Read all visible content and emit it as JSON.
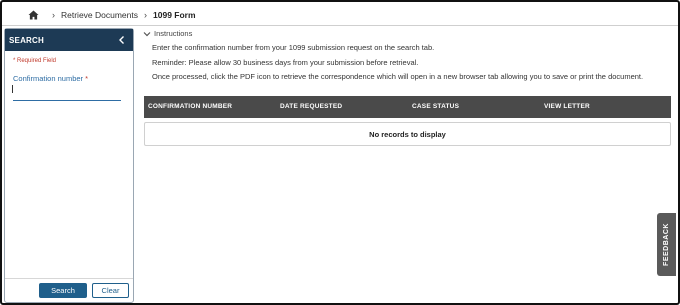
{
  "breadcrumb": {
    "home_icon": "home-icon",
    "items": [
      "Retrieve Documents",
      "1099 Form"
    ]
  },
  "sidebar": {
    "title": "SEARCH",
    "collapse_icon": "chevron-left-icon",
    "required_note": "* Required Field",
    "confirmation_label": "Confirmation number",
    "required_marker": "*",
    "confirmation_value": "",
    "search_button": "Search",
    "clear_button": "Clear"
  },
  "instructions": {
    "toggle_label": "Instructions",
    "lines": [
      "Enter the confirmation number from your 1099 submission request on the search tab.",
      "Reminder: Please allow 30 business days from your submission before retrieval.",
      "Once processed, click the PDF icon to retrieve the correspondence which will open in a new browser tab allowing you to save or print the document."
    ]
  },
  "table": {
    "columns": [
      "CONFIRMATION NUMBER",
      "DATE REQUESTED",
      "CASE STATUS",
      "VIEW LETTER"
    ],
    "empty_message": "No records to display"
  },
  "feedback": {
    "label": "FEEDBACK"
  },
  "colors": {
    "sidebar_header": "#1d3a55",
    "table_header": "#4a4a4a",
    "primary_button": "#1f5f8b",
    "required": "#c0392b",
    "feedback_tab": "#5a5a5a"
  }
}
